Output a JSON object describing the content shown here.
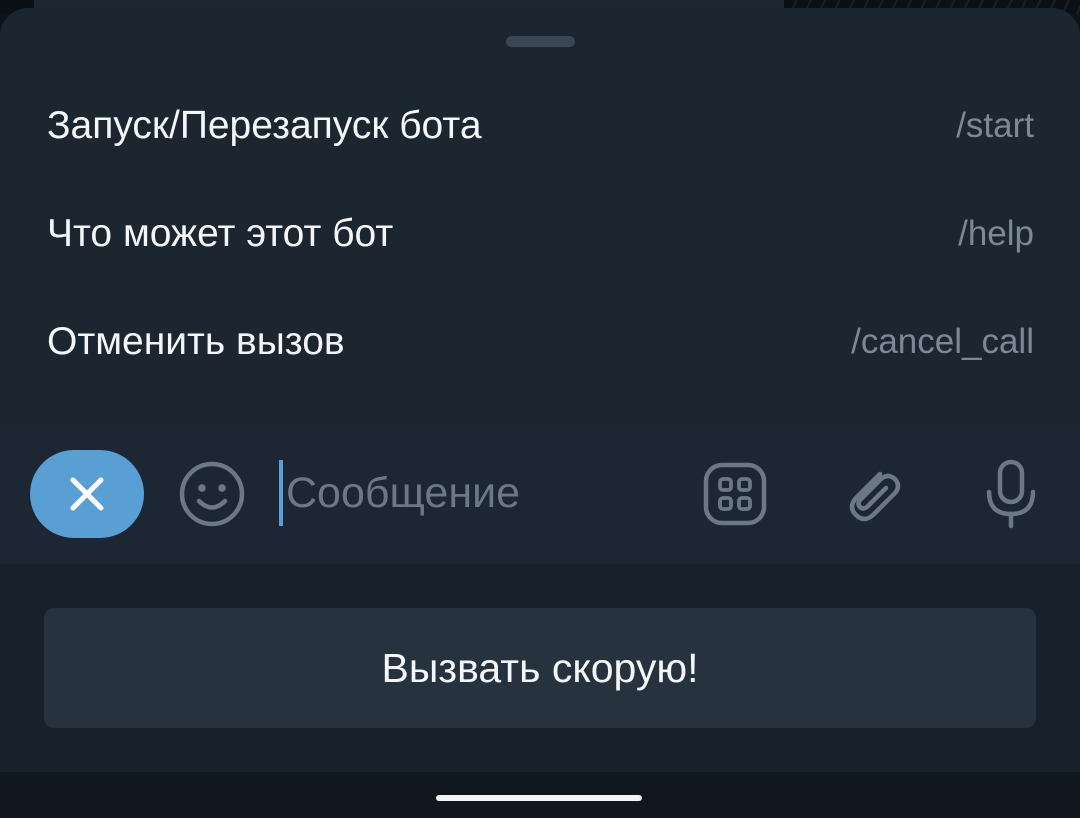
{
  "commands": [
    {
      "title": "Запуск/Перезапуск бота",
      "code": "/start"
    },
    {
      "title": "Что может этот бот",
      "code": "/help"
    },
    {
      "title": "Отменить вызов",
      "code": "/cancel_call"
    }
  ],
  "input": {
    "placeholder": "Сообщение",
    "value": ""
  },
  "icons": {
    "close": "close-icon",
    "emoji": "emoji-icon",
    "commands": "commands-grid-icon",
    "attach": "paperclip-icon",
    "mic": "microphone-icon"
  },
  "keyboard": {
    "button_label": "Вызвать скорую!"
  },
  "colors": {
    "accent": "#5a9fd4",
    "sheet_bg": "#1c2631",
    "muted_text": "#7d8895"
  }
}
